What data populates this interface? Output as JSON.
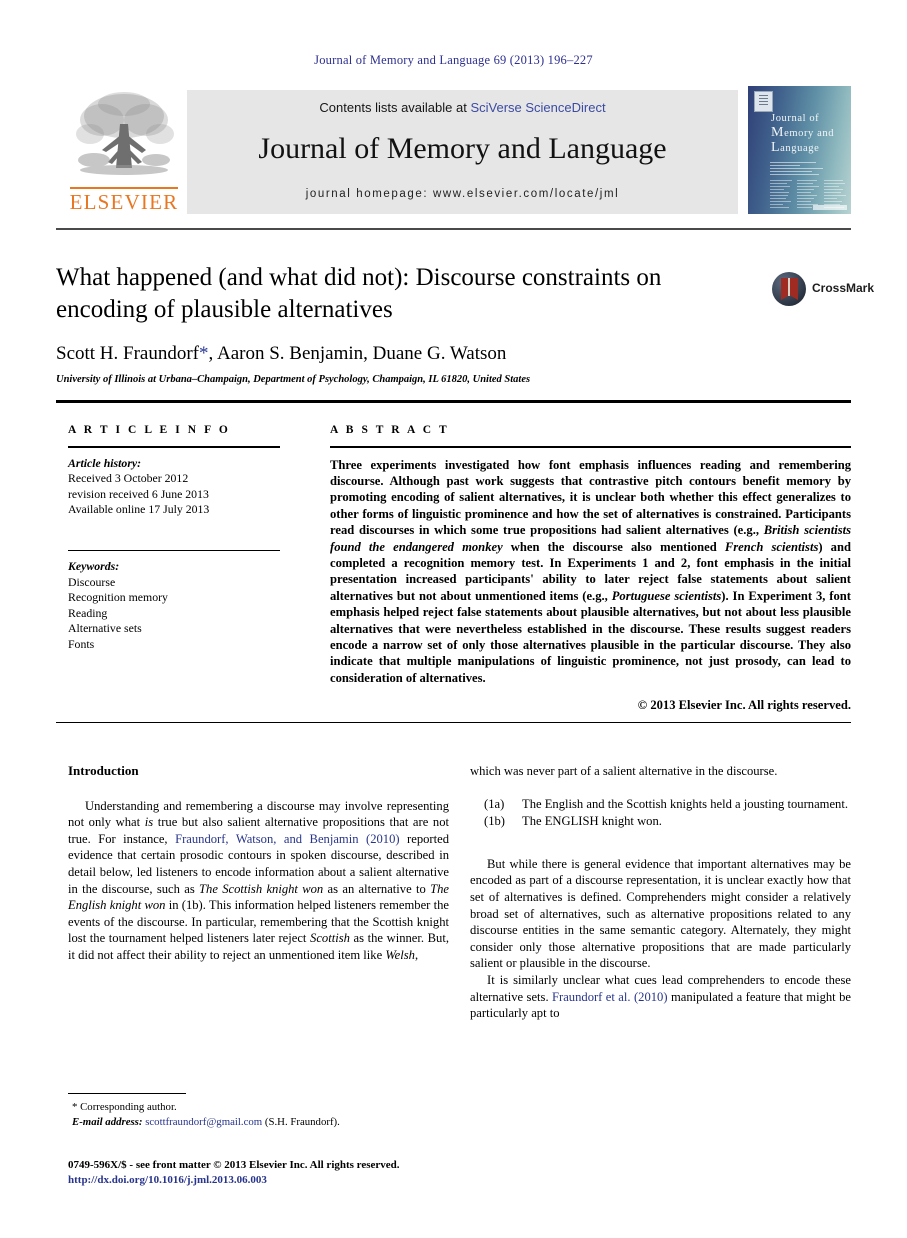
{
  "running_head": "Journal of Memory and Language 69 (2013) 196–227",
  "masthead": {
    "contents_prefix": "Contents lists available at ",
    "sciencedirect": "SciVerse ScienceDirect",
    "journal_title": "Journal of Memory and Language",
    "homepage": "journal homepage: www.elsevier.com/locate/jml",
    "publisher_logo_text": "ELSEVIER",
    "cover": {
      "title_line1": "ournal of",
      "title_line2": "emory and",
      "title_line3": "anguage",
      "initial1": "J",
      "initial2": "M",
      "initial3": "L"
    }
  },
  "article": {
    "title": "What happened (and what did not): Discourse constraints on encoding of plausible alternatives",
    "authors": "Scott H. Fraundorf",
    "authors_star": "*",
    "authors_rest": ", Aaron S. Benjamin, Duane G. Watson",
    "affiliation": "University of Illinois at Urbana–Champaign, Department of Psychology, Champaign, IL 61820, United States",
    "crossmark_label": "CrossMark"
  },
  "article_info": {
    "heading": "A R T I C L E   I N F O",
    "history_label": "Article history:",
    "history": [
      "Received 3 October 2012",
      "revision received 6 June 2013",
      "Available online 17 July 2013"
    ],
    "keywords_label": "Keywords:",
    "keywords": [
      "Discourse",
      "Recognition memory",
      "Reading",
      "Alternative sets",
      "Fonts"
    ]
  },
  "abstract": {
    "heading": "A B S T R A C T",
    "para_1": "Three experiments investigated how font emphasis influences reading and remembering discourse. Although past work suggests that contrastive pitch contours benefit memory by promoting encoding of salient alternatives, it is unclear both whether this effect generalizes to other forms of linguistic prominence and how the set of alternatives is constrained. Participants read discourses in which some true propositions had salient alternatives (e.g., ",
    "italic_1": "British scientists found the endangered monkey",
    "para_2": " when the discourse also mentioned ",
    "italic_2": "French scientists",
    "para_3": ") and completed a recognition memory test. In Experiments 1 and 2, font emphasis in the initial presentation increased participants' ability to later reject false statements about salient alternatives but not about unmentioned items (e.g., ",
    "italic_3": "Portuguese scientists",
    "para_4": "). In Experiment 3, font emphasis helped reject false statements about plausible alternatives, but not about less plausible alternatives that were nevertheless established in the discourse. These results suggest readers encode a narrow set of only those alternatives plausible in the particular discourse. They also indicate that multiple manipulations of linguistic prominence, not just prosody, can lead to consideration of alternatives.",
    "copyright": "© 2013 Elsevier Inc. All rights reserved."
  },
  "body": {
    "intro_heading": "Introduction",
    "left_p1_a": "Understanding and remembering a discourse may involve representing not only what ",
    "left_p1_is": "is",
    "left_p1_b": " true but also salient alternative propositions that are not true. For instance, ",
    "left_p1_cite": "Fraundorf, Watson, and Benjamin (2010)",
    "left_p1_c": " reported evidence that certain prosodic contours in spoken discourse, described in detail below, led listeners to encode information about a salient alternative in the discourse, such as ",
    "left_p1_i1": "The Scottish knight won",
    "left_p1_d": " as an alternative to ",
    "left_p1_i2": "The English knight won",
    "left_p1_e": " in (1b). This information helped listeners remember the events of the discourse. In particular, remembering that the Scottish knight lost the tournament helped listeners later reject ",
    "left_p1_i3": "Scottish",
    "left_p1_f": " as the winner. But, it did not affect their ability to reject an unmentioned item like ",
    "left_p1_i4": "Welsh",
    "left_p1_g": ",",
    "right_p1": "which was never part of a salient alternative in the discourse.",
    "examples": [
      {
        "num": "(1a)",
        "text": "The English and the Scottish knights held a jousting tournament."
      },
      {
        "num": "(1b)",
        "text": "The ENGLISH knight won."
      }
    ],
    "right_p2": "But while there is general evidence that important alternatives may be encoded as part of a discourse representation, it is unclear exactly how that set of alternatives is defined. Comprehenders might consider a relatively broad set of alternatives, such as alternative propositions related to any discourse entities in the same semantic category. Alternately, they might consider only those alternative propositions that are made particularly salient or plausible in the discourse.",
    "right_p3_a": "It is similarly unclear what cues lead comprehenders to encode these alternative sets. ",
    "right_p3_cite": "Fraundorf et al. (2010)",
    "right_p3_b": " manipulated a feature that might be particularly apt to"
  },
  "footnote": {
    "corresponding": "* Corresponding author.",
    "email_label": "E-mail address:",
    "email": "scottfraundorf@gmail.com",
    "email_suffix": " (S.H. Fraundorf)."
  },
  "imprint": {
    "line1": "0749-596X/$ - see front matter © 2013 Elsevier Inc. All rights reserved.",
    "doi": "http://dx.doi.org/10.1016/j.jml.2013.06.003"
  },
  "colors": {
    "running_head": "#2d2f8f",
    "link": "#27348b",
    "elsevier_orange": "#e87722",
    "band": "#e6e6e6"
  }
}
